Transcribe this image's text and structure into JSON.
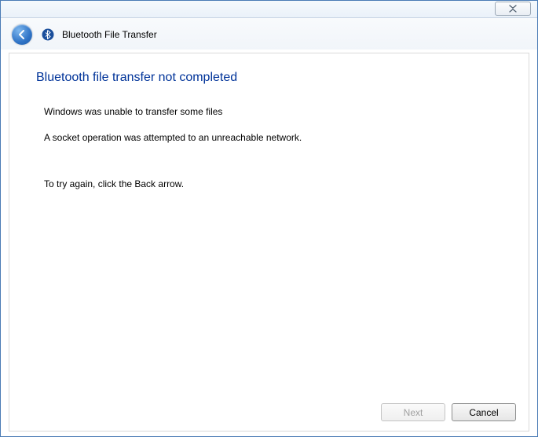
{
  "window": {
    "title": "Bluetooth File Transfer"
  },
  "content": {
    "heading": "Bluetooth file transfer not completed",
    "line1": "Windows was unable to transfer some files",
    "line2": "A socket operation was attempted to an unreachable network.",
    "retry_hint": "To try again, click the Back arrow."
  },
  "buttons": {
    "next": "Next",
    "cancel": "Cancel"
  }
}
